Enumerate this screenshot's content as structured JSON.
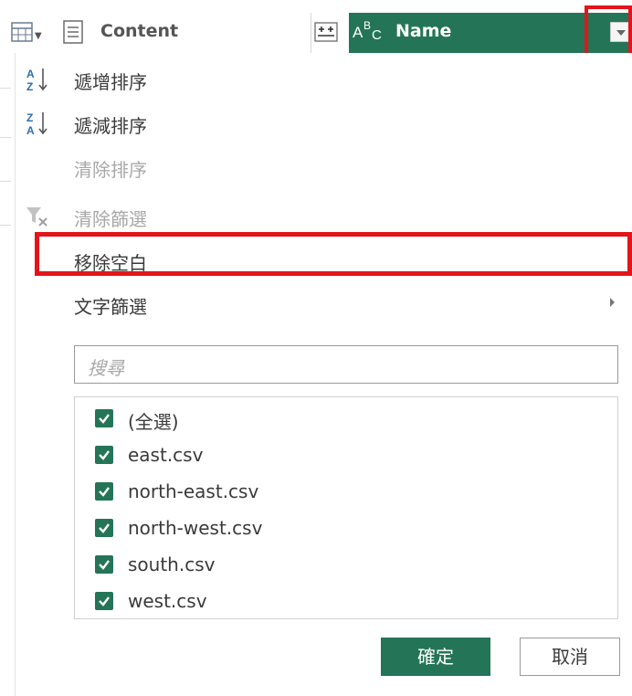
{
  "header": {
    "content_column_label": "Content",
    "name_column_label": "Name",
    "table_icon": "table-icon",
    "column_icon": "text-column-icon",
    "binary_icon": "binary-type-icon",
    "abc_icon": "abc-type-icon",
    "accent_color": "#247557",
    "highlight_color": "#e4141b"
  },
  "menu": {
    "sort_ascending": "遞增排序",
    "sort_descending": "遞減排序",
    "clear_sort": "清除排序",
    "clear_filter": "清除篩選",
    "remove_empty": "移除空白",
    "text_filters": "文字篩選"
  },
  "search": {
    "placeholder": "搜尋"
  },
  "list": {
    "items": [
      {
        "label": "(全選)",
        "checked": true
      },
      {
        "label": "east.csv",
        "checked": true
      },
      {
        "label": "north-east.csv",
        "checked": true
      },
      {
        "label": "north-west.csv",
        "checked": true
      },
      {
        "label": "south.csv",
        "checked": true
      },
      {
        "label": "west.csv",
        "checked": true
      }
    ]
  },
  "buttons": {
    "ok": "確定",
    "cancel": "取消"
  }
}
